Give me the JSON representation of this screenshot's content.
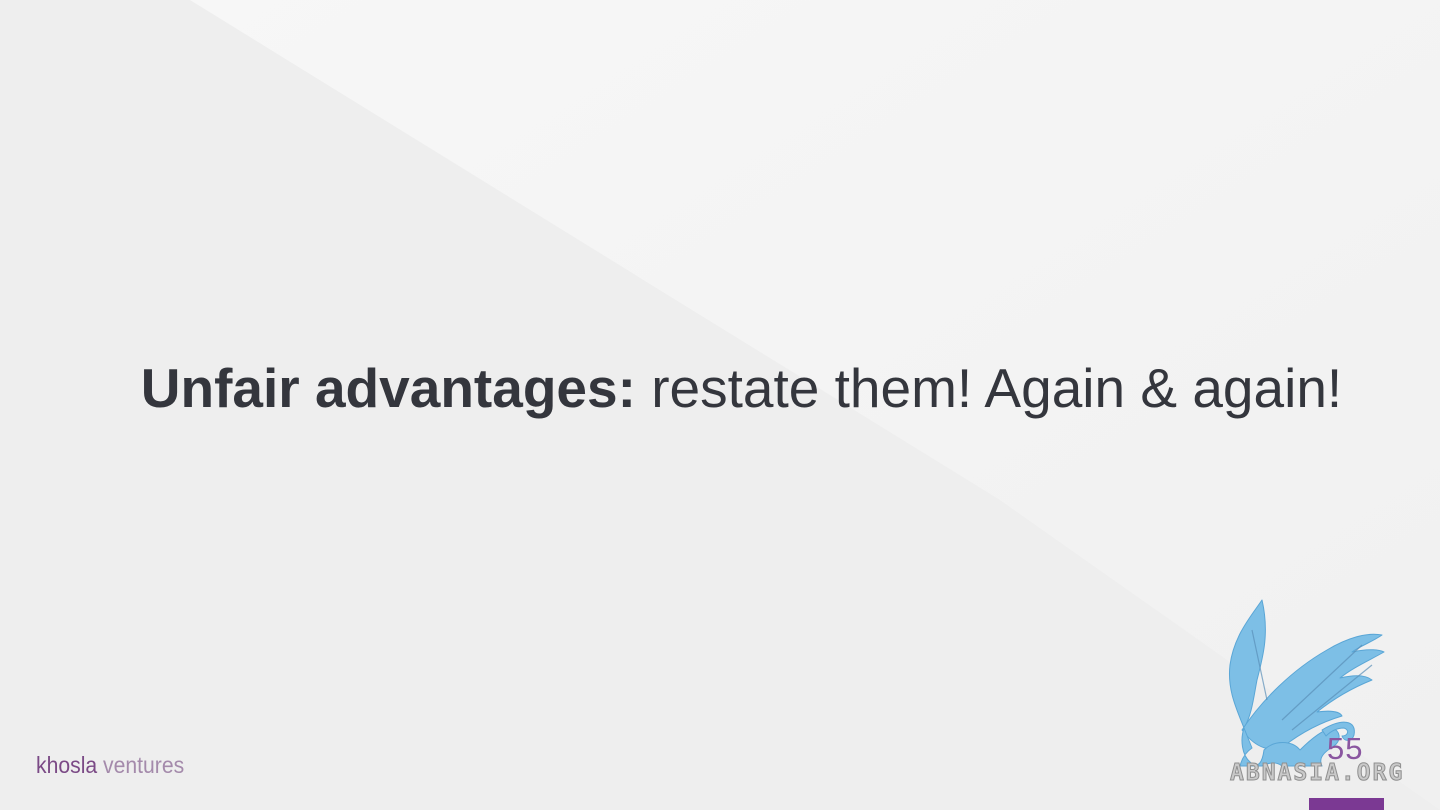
{
  "slide": {
    "headline_bold": "Unfair advantages:",
    "headline_rest": " restate them! Again & again!",
    "page_number": "55"
  },
  "brand": {
    "word1": "khosla",
    "word2": "ventures"
  },
  "watermark": {
    "text": "ABNASIA.ORG",
    "icon": "griffin-logo-icon"
  },
  "colors": {
    "headline": "#34363d",
    "brand_primary": "#7b4a86",
    "brand_secondary": "#a48aab",
    "accent": "#7b3993",
    "watermark_blue": "#7dbfe6"
  }
}
